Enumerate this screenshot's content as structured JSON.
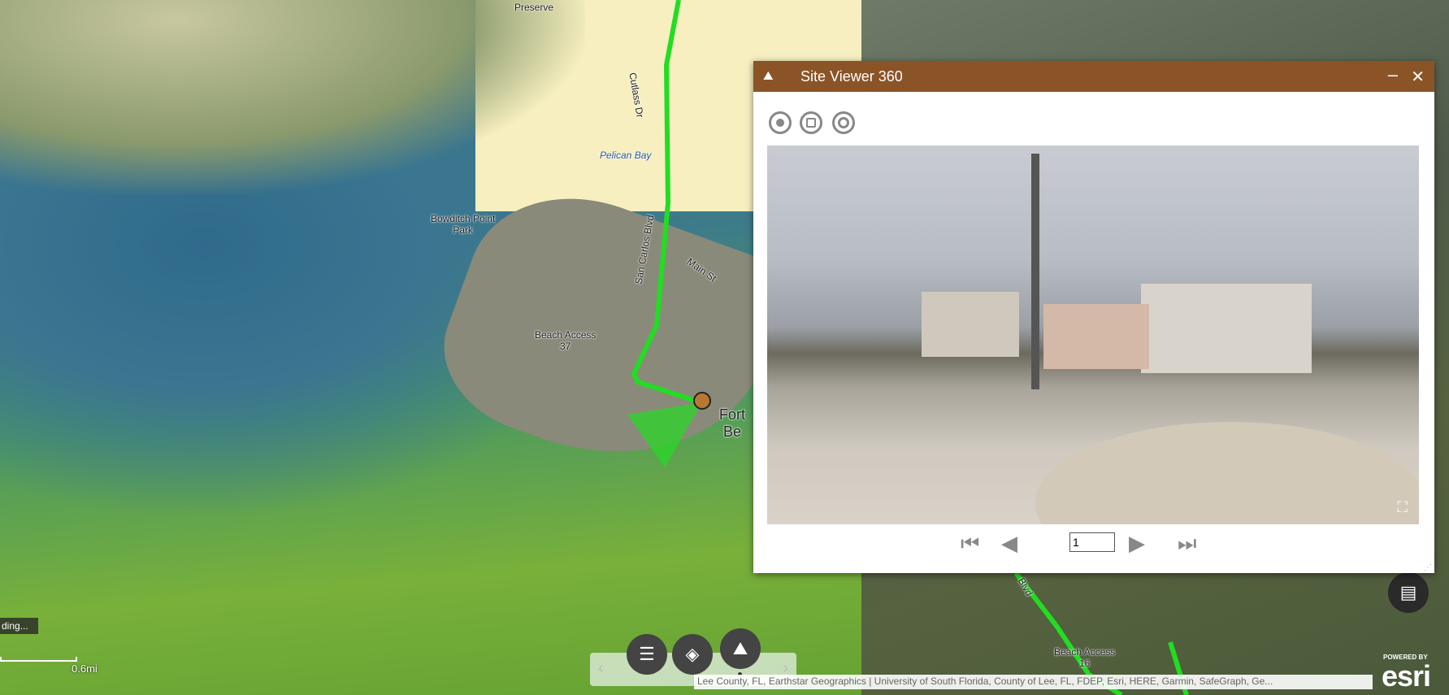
{
  "map": {
    "labels": {
      "preserve": "Preserve",
      "bowditch": "Bowditch Point\nPark",
      "pelican": "Pelican Bay",
      "beach37": "Beach Access\n37",
      "main": "Main St",
      "sancarlos": "San Carlos Blvd",
      "cutlass": "Cutlass Dr",
      "fort": "Fort\nBe",
      "beach16": "Beach Access\n16",
      "blvd": "Blvd"
    },
    "loading": "ding...",
    "scale": "0.6mi",
    "attribution": "Lee County, FL, Earthstar Geographics | University of South Florida, County of Lee, FL, FDEP, Esri, HERE, Garmin, SafeGraph, Ge...",
    "esri_powered": "POWERED BY",
    "esri": "esri",
    "route_color": "#22dd22"
  },
  "panel": {
    "title": "Site Viewer 360",
    "minimize": "–",
    "close": "✕",
    "header_color": "#8b5427",
    "page": "1"
  },
  "toolbar": {
    "icons": [
      "list-icon",
      "layers-icon",
      "site-viewer-icon"
    ],
    "prev": "‹",
    "next": "›"
  },
  "legend_icon": "legend-icon"
}
